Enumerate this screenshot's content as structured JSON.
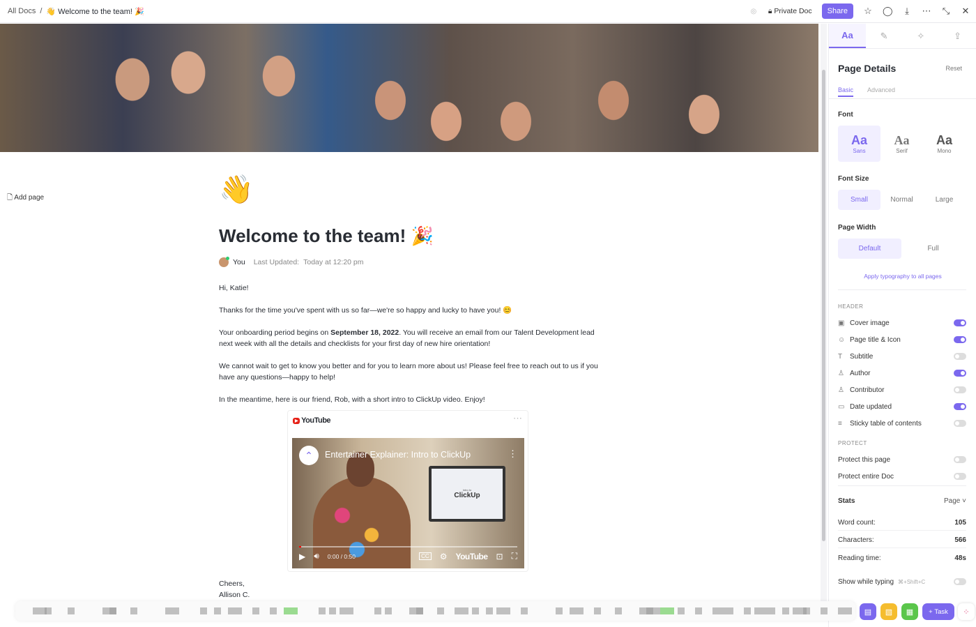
{
  "topbar": {
    "breadcrumb_root": "All Docs",
    "breadcrumb_sep": "/",
    "breadcrumb_page": "👋 Welcome to the team! 🎉",
    "private_label": "Private Doc",
    "share_label": "Share"
  },
  "sidebar": {
    "add_page": "Add page"
  },
  "doc": {
    "icon": "👋",
    "title": "Welcome to the team! 🎉",
    "author": "You",
    "updated_label": "Last Updated:",
    "updated_value": "Today at 12:20 pm",
    "greeting": "Hi, Katie!",
    "p1": "Thanks for the time you've spent with us so far—we're so happy and lucky to have you! 😊",
    "p2_a": "Your onboarding period begins on ",
    "p2_date": "September 18, 2022",
    "p2_b": ". You will receive an email from our Talent Development lead next week with all the details and checklists for your first day of new hire orientation!",
    "p3": "We cannot wait to get to know you better and for you to learn more about us! Please feel free to reach out to us if you have any questions—happy to help!",
    "p4": "In the meantime, here is our friend, Rob, with a short intro to ClickUp video. Enjoy!",
    "embed": {
      "provider": "YouTube",
      "video_title": "Entertainer Explainer: Intro to ClickUp",
      "screen_small": "Intro to",
      "screen_brand": "ClickUp",
      "time": "0:00 / 0:50",
      "progress": 0.01,
      "yt_logo": "YouTube"
    },
    "closing": "Cheers,",
    "signature": "Allison C."
  },
  "panel": {
    "tabs": [
      "Aa",
      "brush",
      "sparkle",
      "export"
    ],
    "title": "Page Details",
    "reset": "Reset",
    "subtabs": [
      "Basic",
      "Advanced"
    ],
    "font_label": "Font",
    "fonts": [
      {
        "glyph": "Aa",
        "name": "Sans",
        "selected": true
      },
      {
        "glyph": "Aa",
        "name": "Serif",
        "selected": false
      },
      {
        "glyph": "Aa",
        "name": "Mono",
        "selected": false
      }
    ],
    "size_label": "Font Size",
    "sizes": [
      "Small",
      "Normal",
      "Large"
    ],
    "size_selected": "Small",
    "width_label": "Page Width",
    "widths": [
      "Default",
      "Full"
    ],
    "width_selected": "Default",
    "apply_link": "Apply typography to all pages",
    "header_caption": "HEADER",
    "header_items": [
      {
        "icon": "image-icon",
        "glyph": "▣",
        "label": "Cover image",
        "on": true
      },
      {
        "icon": "smiley-icon",
        "glyph": "☺",
        "label": "Page title & Icon",
        "on": true
      },
      {
        "icon": "subtitle-icon",
        "glyph": "T",
        "label": "Subtitle",
        "on": false
      },
      {
        "icon": "user-icon",
        "glyph": "♙",
        "label": "Author",
        "on": true
      },
      {
        "icon": "users-icon",
        "glyph": "♙",
        "label": "Contributor",
        "on": false
      },
      {
        "icon": "calendar-icon",
        "glyph": "▭",
        "label": "Date updated",
        "on": true
      },
      {
        "icon": "list-icon",
        "glyph": "≡",
        "label": "Sticky table of contents",
        "on": false
      }
    ],
    "protect_caption": "PROTECT",
    "protect_items": [
      {
        "label": "Protect this page",
        "on": false
      },
      {
        "label": "Protect entire Doc",
        "on": false
      }
    ],
    "stats_label": "Stats",
    "stats_scope": "Page",
    "stats": [
      {
        "label": "Word count:",
        "value": "105"
      },
      {
        "label": "Characters:",
        "value": "566"
      },
      {
        "label": "Reading time:",
        "value": "48s"
      }
    ],
    "typing_label": "Show while typing",
    "typing_shortcut": "⌘+Shift+C",
    "typing_on": false
  },
  "dock": {
    "task_label": "Task"
  },
  "colors": {
    "accent": "#7b68ee",
    "yellow": "#f5bd2f",
    "green": "#5bc64b"
  }
}
